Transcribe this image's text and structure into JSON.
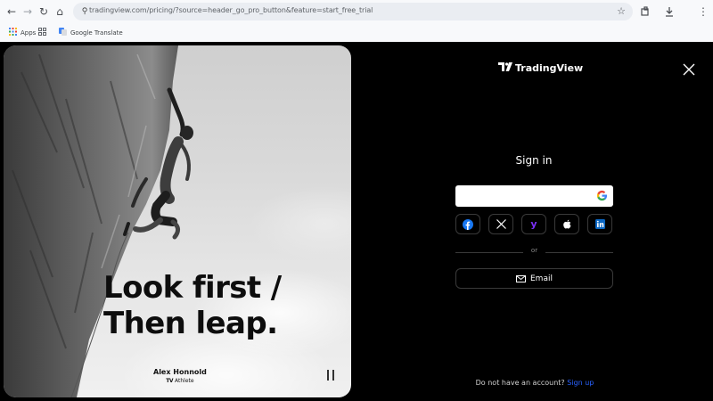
{
  "browser": {
    "url": "tradingview.com/pricing/?source=header_go_pro_button&feature=start_free_trial",
    "bookmarks": [
      {
        "label": "Apps",
        "icon": "apps-grid-icon"
      },
      {
        "label": "",
        "icon": "google-apps-icon"
      },
      {
        "label": "Google Translate",
        "icon": "google-translate-icon"
      }
    ]
  },
  "hero": {
    "headline_line1": "Look first /",
    "headline_line2": "Then leap.",
    "athlete_name": "Alex Honnold",
    "athlete_role": "Athlete"
  },
  "panel": {
    "logo_text": "TradingView",
    "title": "Sign in",
    "social_buttons": [
      "facebook-icon",
      "x-icon",
      "yahoo-icon",
      "apple-icon",
      "linkedin-icon"
    ],
    "divider_text": "or",
    "email_label": "Email",
    "signup_prompt": "Do not have an account?",
    "signup_link": "Sign up"
  },
  "colors": {
    "page_bg": "#000000",
    "link": "#2962ff",
    "border": "#3a3a3a"
  }
}
